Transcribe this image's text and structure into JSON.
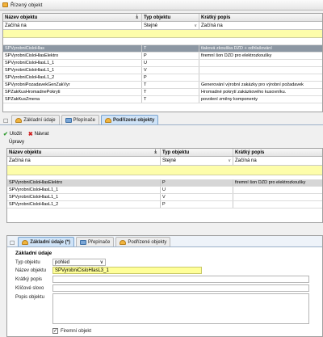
{
  "window": {
    "title": "Řízený objekt"
  },
  "top_grid": {
    "columns": [
      "Název objektu",
      "Typ objektu",
      "Krátký popis"
    ],
    "filters": [
      "Začíná na",
      "Stejné",
      "Začíná na"
    ],
    "rows": [
      [
        "SPVyrobniCisloHlas",
        "T",
        "tlaková zkouška DZD + odhlašování"
      ],
      [
        "SPVyrobniCisloHlasElektro",
        "P",
        "firemní šon DZD pro elektrozkoušky"
      ],
      [
        "SPVyrobniCisloHlasL1_1",
        "U",
        ""
      ],
      [
        "SPVyrobniCisloHlasL1_1",
        "V",
        ""
      ],
      [
        "SPVyrobniCisloHlasL1_2",
        "P",
        ""
      ],
      [
        "SPVyrobniPozadavekGenZakVyr",
        "T",
        "Generování výrobní zakázky pro výrobní požadavek"
      ],
      [
        "SPZakKusHromadnePokryti",
        "T",
        "Hromadné pokrytí zakázkového kusovníku."
      ],
      [
        "SPZakKusZmena",
        "T",
        "povolení změny komponenty"
      ]
    ]
  },
  "middle_tabs": [
    "Základní údaje",
    "Přepínače",
    "Podřízené objekty"
  ],
  "toolbar": {
    "save": "Uložit",
    "back": "Návrat",
    "edits": "Úpravy"
  },
  "mid_grid": {
    "columns": [
      "Název objektu",
      "Typ objektu",
      "Krátký popis"
    ],
    "filters": [
      "Začíná na",
      "Stejné",
      "Začíná na"
    ],
    "rows": [
      [
        "SPVyrobniCisloHlasElektro",
        "P",
        "firemní šon DZD pro elektrozkoušky"
      ],
      [
        "SPVyrobniCisloHlasL1_1",
        "U",
        ""
      ],
      [
        "SPVyrobniCisloHlasL1_1",
        "V",
        ""
      ],
      [
        "SPVyrobniCisloHlasL1_2",
        "P",
        ""
      ]
    ]
  },
  "bottom_tabs": [
    "Základní údaje (*)",
    "Přepínače",
    "Podřízené objekty"
  ],
  "form": {
    "title": "Základní údaje",
    "type_label": "Typ objektu",
    "type_value": "pohled",
    "name_label": "Název objektu",
    "name_value": "SPVyrobniCisloHlasL3_1",
    "short_label": "Krátký popis",
    "keyword_label": "Klíčové slovo",
    "desc_label": "Popis objektu",
    "company_label": "Firemní objekt"
  }
}
